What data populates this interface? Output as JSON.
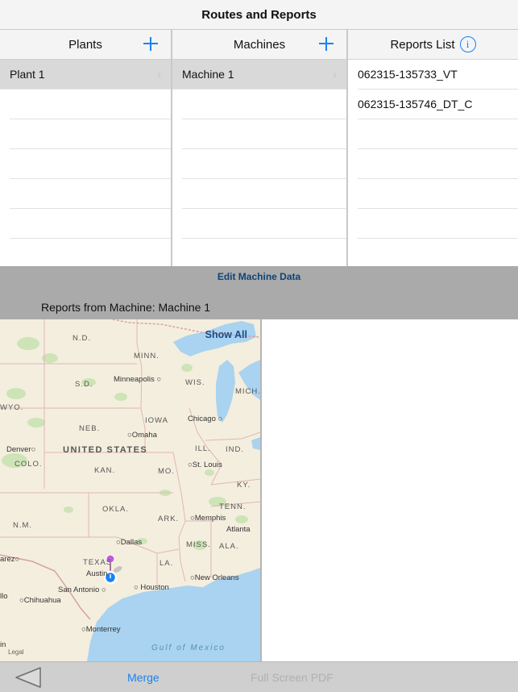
{
  "window": {
    "title": "Routes and Reports"
  },
  "plants": {
    "header": "Plants",
    "items": [
      {
        "label": "Plant 1",
        "selected": true
      }
    ]
  },
  "machines": {
    "header": "Machines",
    "items": [
      {
        "label": "Machine 1",
        "selected": true
      }
    ]
  },
  "reports": {
    "header": "Reports List",
    "items": [
      "062315-135733_VT",
      "062315-135746_DT_C"
    ]
  },
  "edit_bar": {
    "edit_label": "Edit Machine Data",
    "reports_from_label": "Reports from Machine: Machine 1"
  },
  "map": {
    "show_all_label": "Show All",
    "country_label": "UNITED STATES",
    "gulf_label": "Gulf of Mexico",
    "legal_label": "Legal",
    "states": [
      "N.D.",
      "MINN.",
      "S.D.",
      "WIS.",
      "MICH.",
      "NEB.",
      "IOWA",
      "ILL.",
      "IND.",
      "COLO.",
      "KAN.",
      "MO.",
      "KY.",
      "OKLA.",
      "ARK.",
      "TENN.",
      "N.M.",
      "MISS.",
      "ALA.",
      "TEXAS",
      "LA.",
      "WYO."
    ],
    "cities": [
      "Minneapolis",
      "Chicago",
      "Omaha",
      "Denver",
      "St. Louis",
      "Memphis",
      "Atlanta",
      "Dallas",
      "Austin",
      "San Antonio",
      "Houston",
      "New Orleans",
      "Chihuahua",
      "Monterrey",
      "arez",
      "llo",
      "in"
    ],
    "colors": {
      "land": "#f4eede",
      "water": "#a9d3f0",
      "park": "#c7e3b0",
      "pin": "#c45bd8",
      "location": "#1a82f0"
    }
  },
  "toolbar": {
    "back_icon": "back-triangle-icon",
    "merge_label": "Merge",
    "full_pdf_label": "Full Screen PDF"
  },
  "accent": "#1a82f0"
}
